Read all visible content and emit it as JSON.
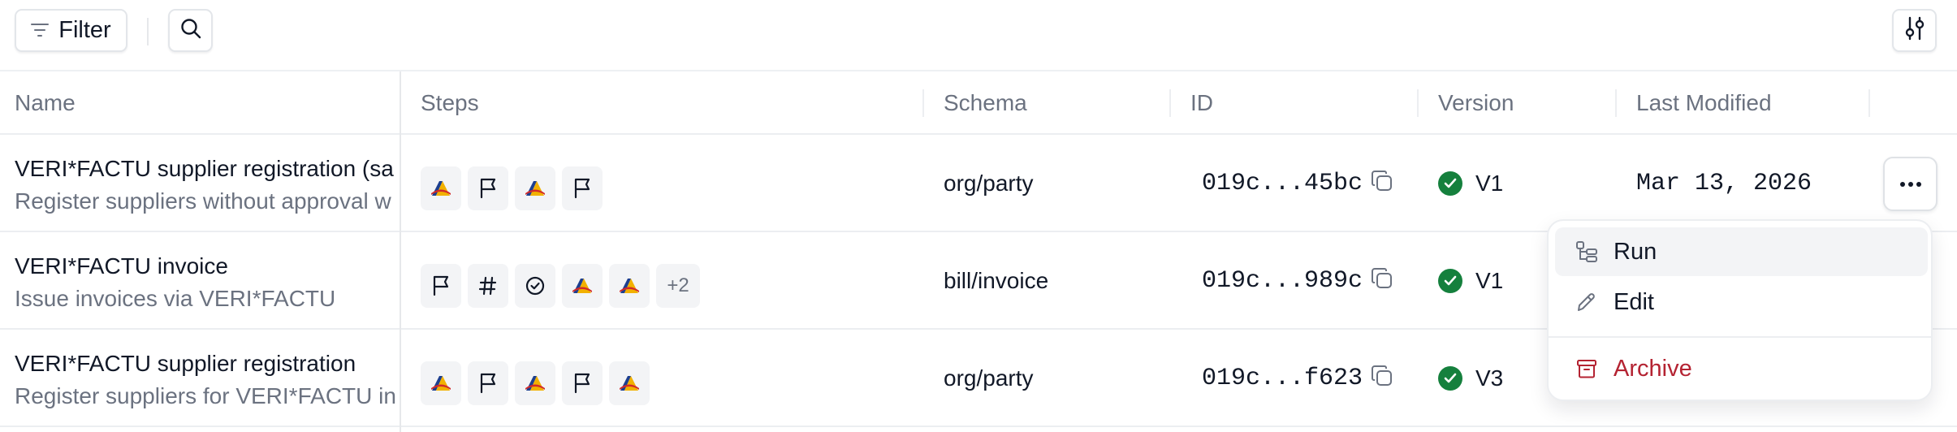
{
  "toolbar": {
    "filter_label": "Filter",
    "search_icon": "search-icon",
    "settings_icon": "sliders-icon"
  },
  "columns": [
    "Name",
    "Steps",
    "Schema",
    "ID",
    "Version",
    "Last Modified"
  ],
  "rows": [
    {
      "name": "VERI*FACTU supplier registration (sa",
      "description": "Register suppliers without approval w",
      "steps": [
        "aeat-logo-icon",
        "flag-icon",
        "aeat-logo-icon",
        "flag-icon"
      ],
      "steps_more": "",
      "schema": "org/party",
      "id": "019c...45bc",
      "version": "V1",
      "last_modified": "Mar 13, 2026"
    },
    {
      "name": "VERI*FACTU invoice",
      "description": "Issue invoices via VERI*FACTU",
      "steps": [
        "flag-icon",
        "hash-icon",
        "check-circle-icon",
        "aeat-logo-icon",
        "aeat-logo-icon"
      ],
      "steps_more": "+2",
      "schema": "bill/invoice",
      "id": "019c...989c",
      "version": "V1",
      "last_modified": ""
    },
    {
      "name": "VERI*FACTU supplier registration",
      "description": "Register suppliers for VERI*FACTU in",
      "steps": [
        "aeat-logo-icon",
        "flag-icon",
        "aeat-logo-icon",
        "flag-icon",
        "aeat-logo-icon"
      ],
      "steps_more": "",
      "schema": "org/party",
      "id": "019c...f623",
      "version": "V3",
      "last_modified": ""
    }
  ],
  "menu": {
    "items": [
      {
        "label": "Run",
        "icon": "workflow-icon"
      },
      {
        "label": "Edit",
        "icon": "pencil-icon"
      },
      {
        "label": "Archive",
        "icon": "archive-icon"
      }
    ]
  },
  "colors": {
    "success": "#15803d",
    "danger": "#b42332",
    "logo_blue": "#1d3f8f",
    "logo_yellow": "#f2b100",
    "logo_red": "#d22a2a"
  }
}
